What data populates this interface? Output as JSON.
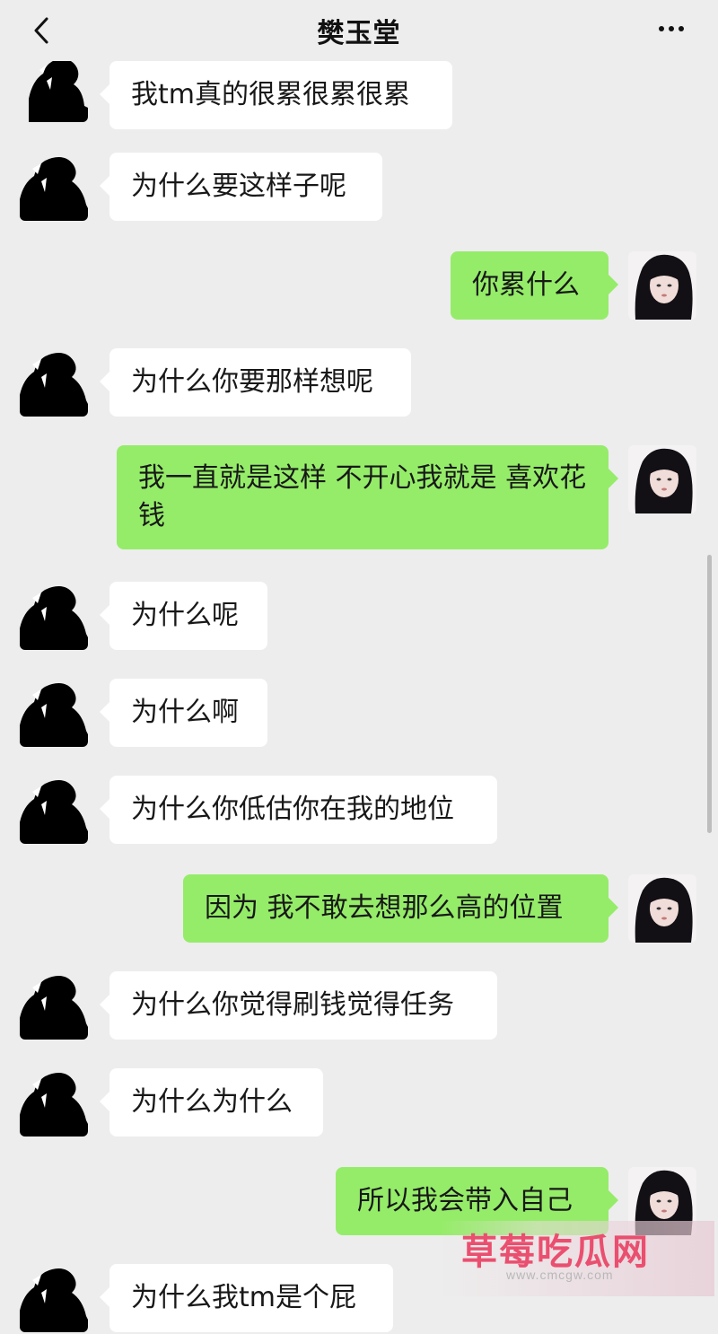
{
  "header": {
    "title": "樊玉堂",
    "back_icon": "chevron-left-icon",
    "more_icon": "more-dots-icon"
  },
  "colors": {
    "background": "#ededed",
    "incoming_bubble": "#ffffff",
    "outgoing_bubble": "#95ec69"
  },
  "messages": [
    {
      "sender": "other",
      "text": "我tm真的很累很累很累"
    },
    {
      "sender": "other",
      "text": "为什么要这样子呢"
    },
    {
      "sender": "me",
      "text": "你累什么"
    },
    {
      "sender": "other",
      "text": "为什么你要那样想呢"
    },
    {
      "sender": "me",
      "text": "我一直就是这样 不开心我就是 喜欢花钱"
    },
    {
      "sender": "other",
      "text": "为什么呢"
    },
    {
      "sender": "other",
      "text": "为什么啊"
    },
    {
      "sender": "other",
      "text": "为什么你低估你在我的地位"
    },
    {
      "sender": "me",
      "text": "因为 我不敢去想那么高的位置"
    },
    {
      "sender": "other",
      "text": "为什么你觉得刷钱觉得任务"
    },
    {
      "sender": "other",
      "text": "为什么为什么"
    },
    {
      "sender": "me",
      "text": "所以我会带入自己"
    },
    {
      "sender": "other",
      "text": "为什么我tm是个屁"
    }
  ],
  "watermark": {
    "main": "草莓吃瓜网",
    "sub": "www.cmcgw.com"
  }
}
